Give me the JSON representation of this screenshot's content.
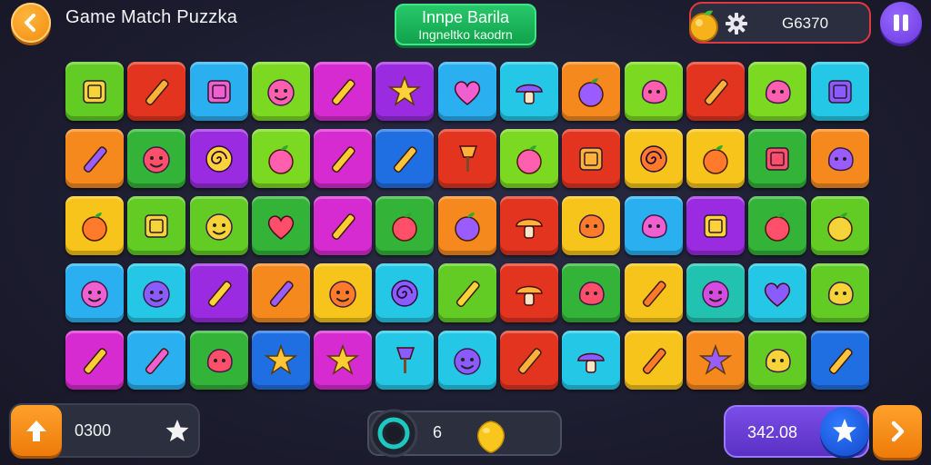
{
  "header": {
    "title": "Game Match Puzzka",
    "banner_line1": "Innpe Barila",
    "banner_line2": "Ingneltko kaodrn",
    "coin_value": "G6370",
    "icons": {
      "back": "back-swirl-icon",
      "coin": "fruit-coin-icon",
      "settings": "gear-icon",
      "pause": "pause-icon"
    }
  },
  "footer": {
    "left_value": "0300",
    "middle_value": "6",
    "right_value": "342.08",
    "icons": {
      "boost": "up-arrow-icon",
      "left_star": "star-icon",
      "ring": "ring-icon",
      "lemon": "lemon-icon",
      "right_star": "star-badge-icon",
      "next": "chevron-right-icon"
    }
  },
  "colors": {
    "background": "#1d1d30",
    "accent_orange": "#f5891e",
    "accent_purple": "#6e3ae0",
    "accent_green": "#10a24c",
    "coin_border": "#e0383e"
  },
  "board": {
    "rows": 5,
    "columns": 13,
    "tiles": [
      [
        "green:frame",
        "red:bread",
        "blue:book",
        "lime:cat-face",
        "magenta:carrot",
        "purple:star",
        "blue:heart-pin",
        "cyan:mushroom",
        "orange:leaf",
        "lime:cat",
        "red:arrow-sprout",
        "lime:smiley-blob",
        "cyan:robot-face"
      ],
      [
        "orange:pencil",
        "dgreen:globe",
        "purple:swirl",
        "lime:potion",
        "magenta:crayon",
        "dblue:eraser",
        "red:pushpin",
        "lime:orange-fruit",
        "red:phone",
        "yellow:spiral",
        "yellow:lemon",
        "dgreen:jar",
        "orange:blob"
      ],
      [
        "yellow:tomato",
        "green:keyboard",
        "green:smiley",
        "dgreen:heart",
        "magenta:axe",
        "dgreen:seed",
        "orange:tomato-face",
        "red:plant-pot",
        "yellow:cat-blob",
        "blue:monster",
        "purple:screen",
        "dgreen:chili",
        "green:tomato"
      ],
      [
        "blue:bear-face",
        "cyan:purple-face",
        "purple:axe",
        "orange:feather",
        "yellow:grin-face",
        "cyan:lollipop",
        "green:pencil",
        "red:cupcake",
        "dgreen:letter-c",
        "yellow:baguette",
        "teal:bubble-face",
        "cyan:balloon",
        "green:peanut-face"
      ],
      [
        "magenta:wand",
        "blue:crayon",
        "dgreen:bell-face",
        "dblue:star-blob",
        "magenta:star",
        "cyan:bucket",
        "cyan:smiley",
        "red:feather",
        "cyan:mushroom",
        "yellow:crayon",
        "orange:star",
        "green:tree-face",
        "dblue:wrench"
      ]
    ]
  }
}
